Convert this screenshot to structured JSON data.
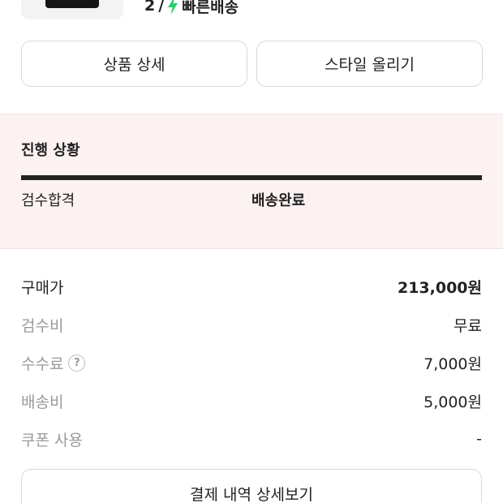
{
  "product": {
    "quantity": "2",
    "separator": "/",
    "delivery_label": "빠른배송",
    "delivery_icon": "bolt-icon",
    "delivery_color": "#2ecc71"
  },
  "actions": {
    "product_detail": "상품 상세",
    "style_upload": "스타일 올리기"
  },
  "progress": {
    "title": "진행 상황",
    "steps": [
      "검수합격",
      "배송완료"
    ],
    "bar_color": "#222222",
    "background": "#fdf2f2"
  },
  "pricing": {
    "rows": [
      {
        "label": "구매가",
        "value": "213,000원"
      },
      {
        "label": "검수비",
        "value": "무료"
      },
      {
        "label": "수수료",
        "value": "7,000원",
        "icon": "help-icon"
      },
      {
        "label": "배송비",
        "value": "5,000원"
      },
      {
        "label": "쿠폰 사용",
        "value": "-"
      }
    ],
    "help_glyph": "?"
  },
  "payment_detail_button": "결제 내역 상세보기"
}
